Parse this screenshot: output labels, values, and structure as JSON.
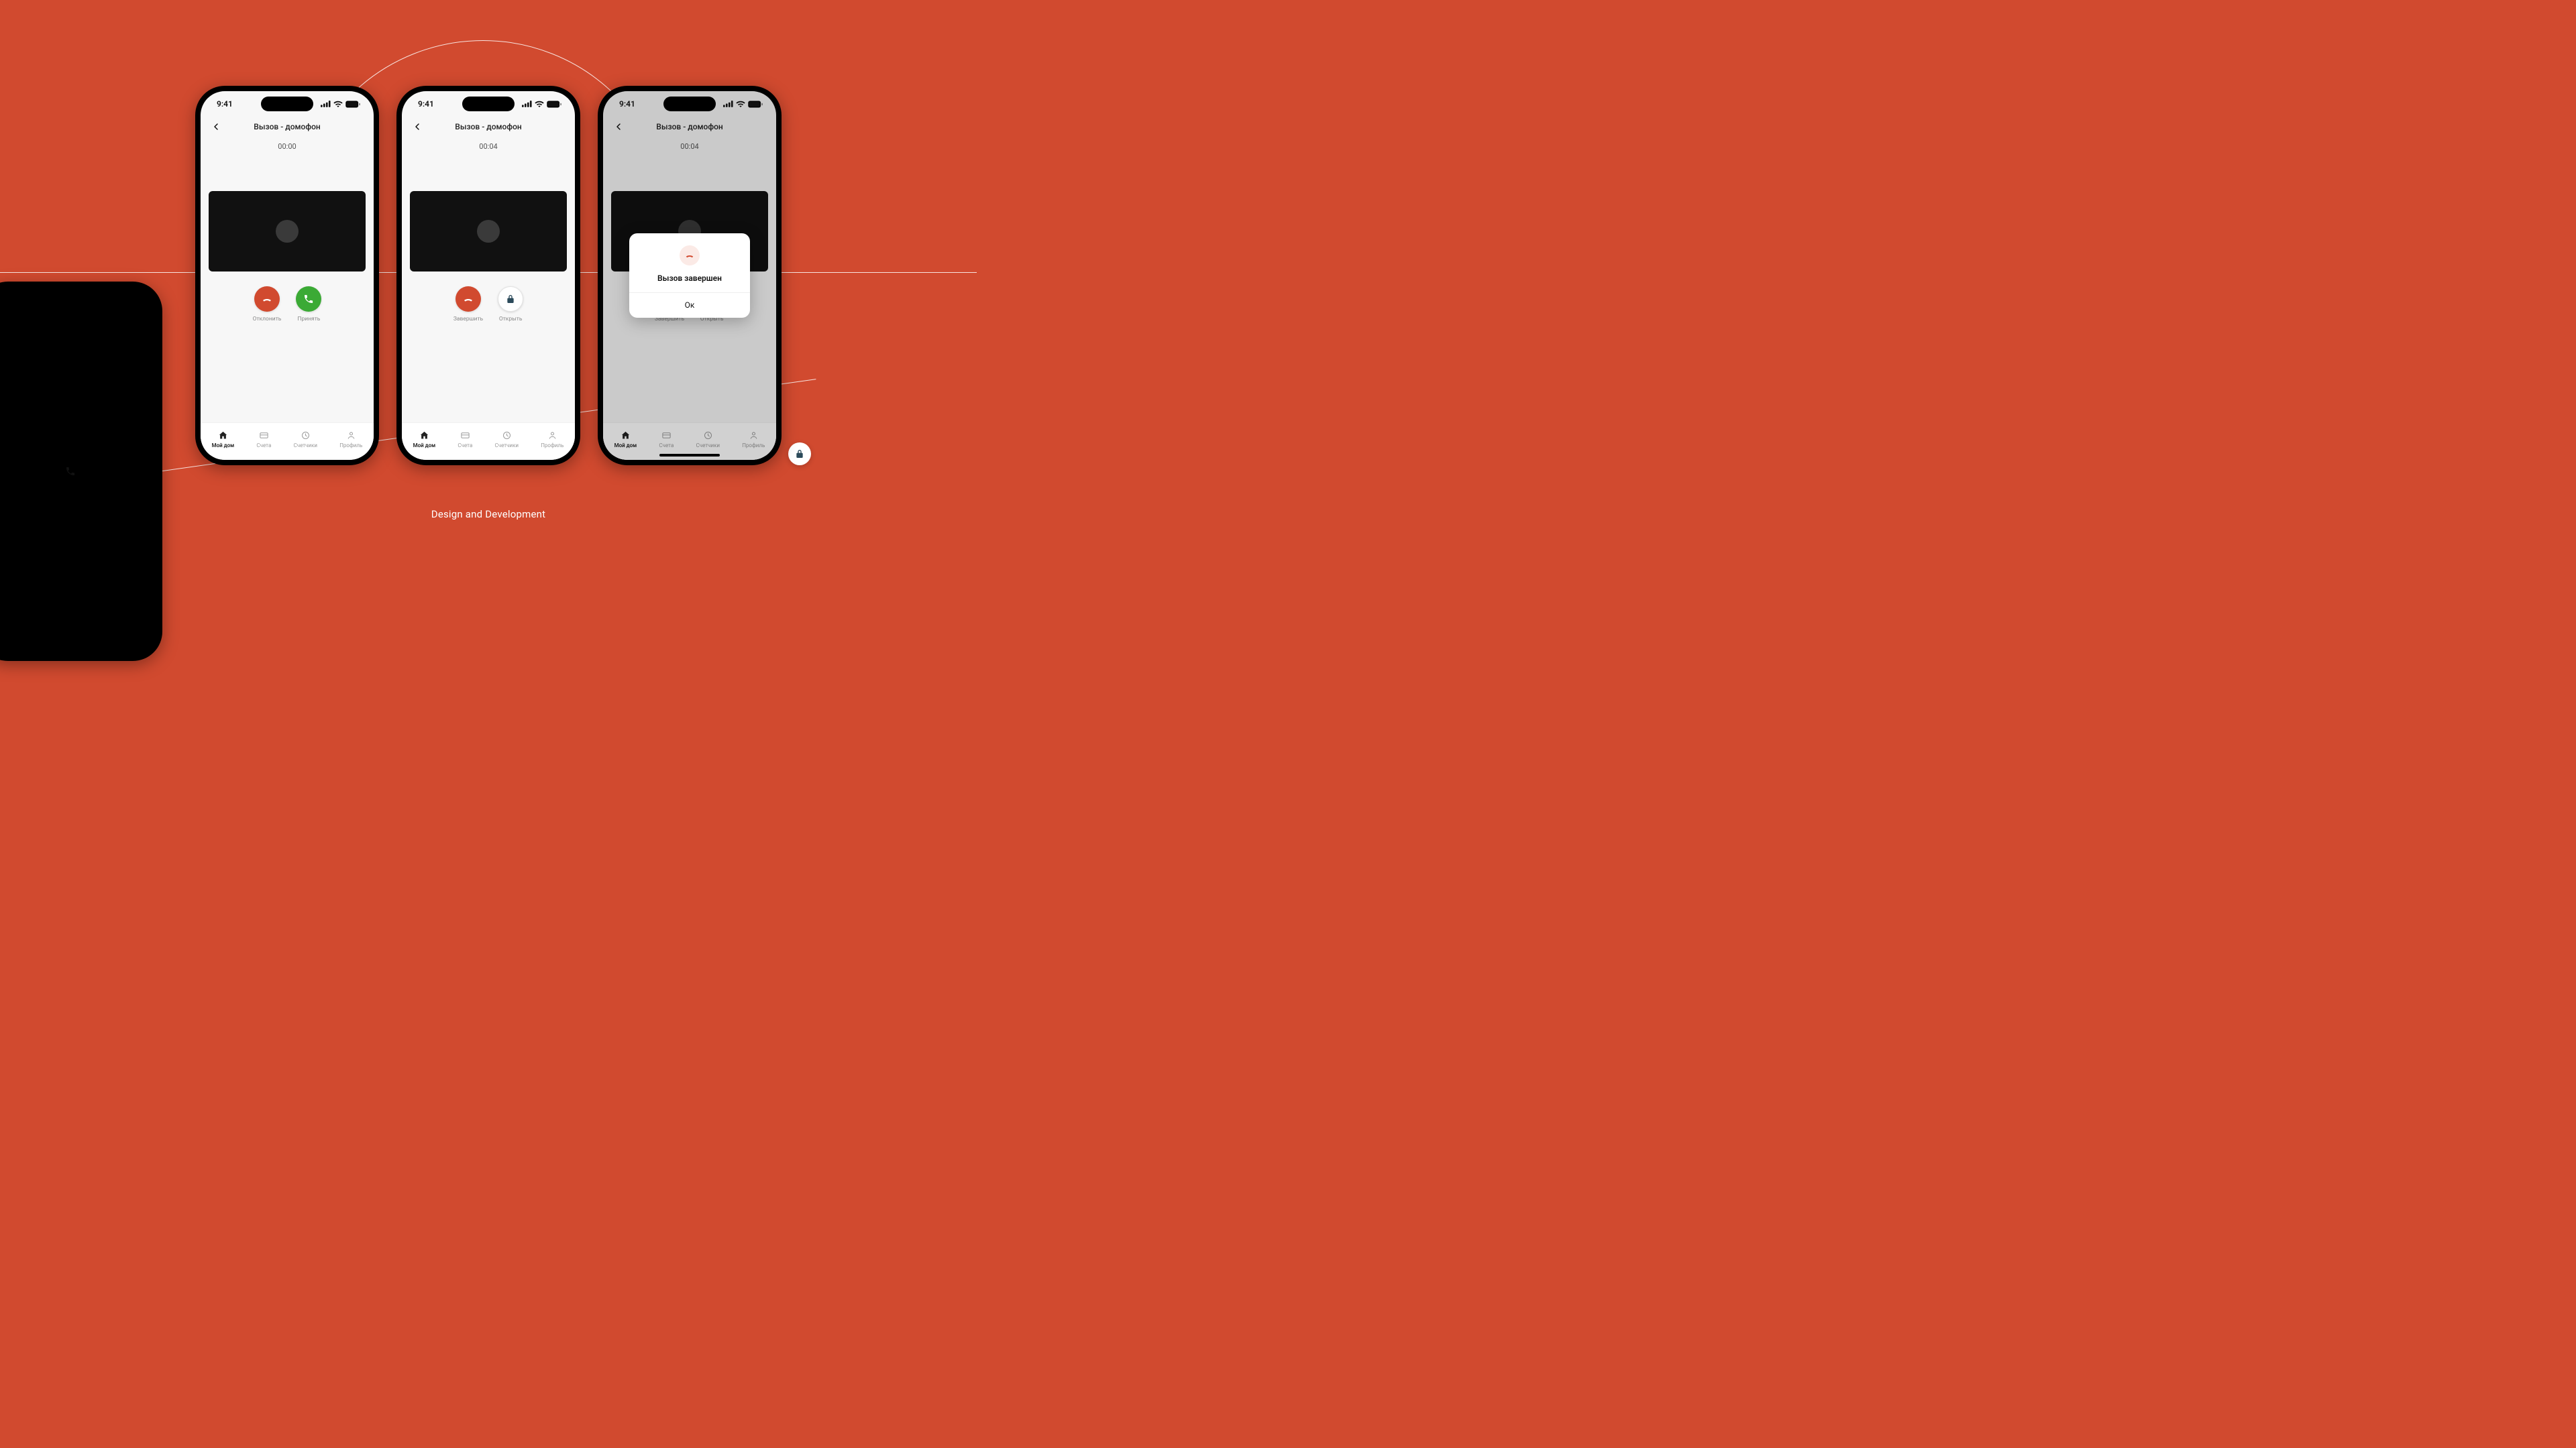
{
  "caption": "Design and Development",
  "statusbar": {
    "time": "9:41"
  },
  "screens": [
    {
      "title": "Вызов - домофон",
      "timer": "00:00",
      "actions": {
        "left": "Отклонить",
        "right": "Принять"
      }
    },
    {
      "title": "Вызов - домофон",
      "timer": "00:04",
      "actions": {
        "left": "Завершить",
        "right": "Открыть"
      }
    },
    {
      "title": "Вызов - домофон",
      "timer": "00:04",
      "actions": {
        "left": "Завершить",
        "right": "Открыть"
      },
      "modal": {
        "title": "Вызов завершен",
        "ok": "Ок"
      }
    }
  ],
  "tabs": [
    "Мой дом",
    "Счета",
    "Счетчики",
    "Профиль"
  ]
}
